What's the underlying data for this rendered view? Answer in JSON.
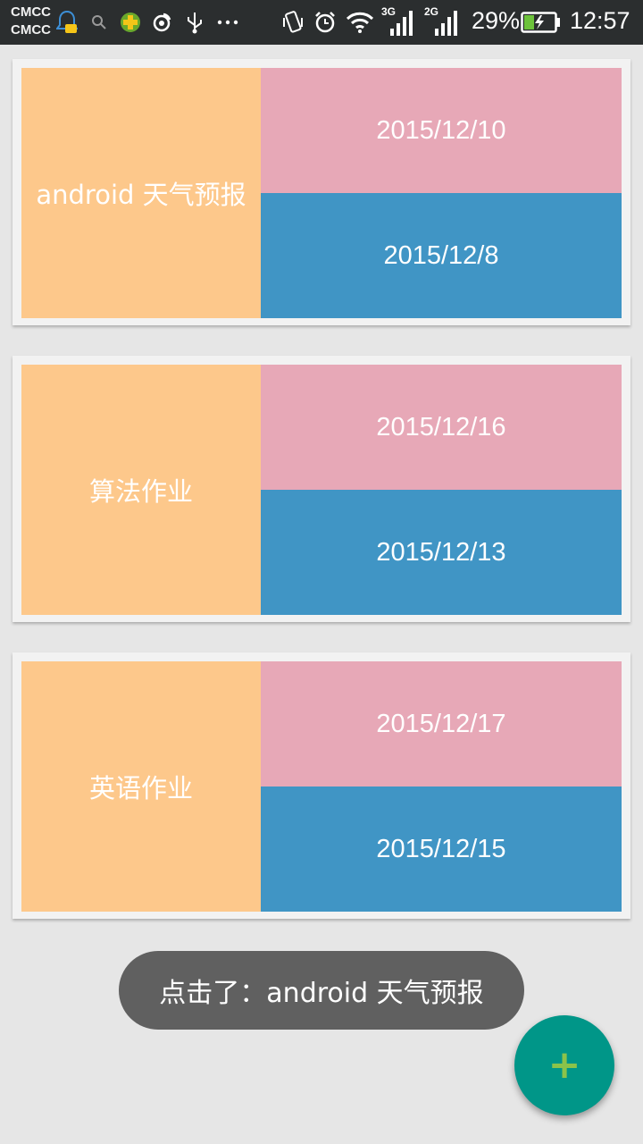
{
  "status_bar": {
    "carrier_1": "CMCC",
    "carrier_2": "CMCC",
    "network_1": "3G",
    "network_2": "2G",
    "battery_percent": "29%",
    "time": "12:57",
    "icons": [
      "qq-icon",
      "search-icon",
      "plus-app-icon",
      "weibo-icon",
      "usb-icon",
      "more-icon",
      "vibrate-icon",
      "alarm-icon",
      "wifi-icon",
      "signal-3g-icon",
      "signal-2g-icon",
      "battery-charging-icon"
    ]
  },
  "cards": [
    {
      "title": "android 天气预报",
      "date_top": "2015/12/10",
      "date_bottom": "2015/12/8"
    },
    {
      "title": "算法作业",
      "date_top": "2015/12/16",
      "date_bottom": "2015/12/13"
    },
    {
      "title": "英语作业",
      "date_top": "2015/12/17",
      "date_bottom": "2015/12/15"
    }
  ],
  "toast": {
    "text": "点击了：android 天气预报"
  },
  "fab": {
    "label": "+",
    "icon": "plus-icon"
  },
  "colors": {
    "title_block": "#fdc88b",
    "top_date_block": "#e7a8b7",
    "bottom_date_block": "#4095c5",
    "fab": "#009688",
    "fab_icon": "#8bc34a",
    "toast": "#606060"
  }
}
